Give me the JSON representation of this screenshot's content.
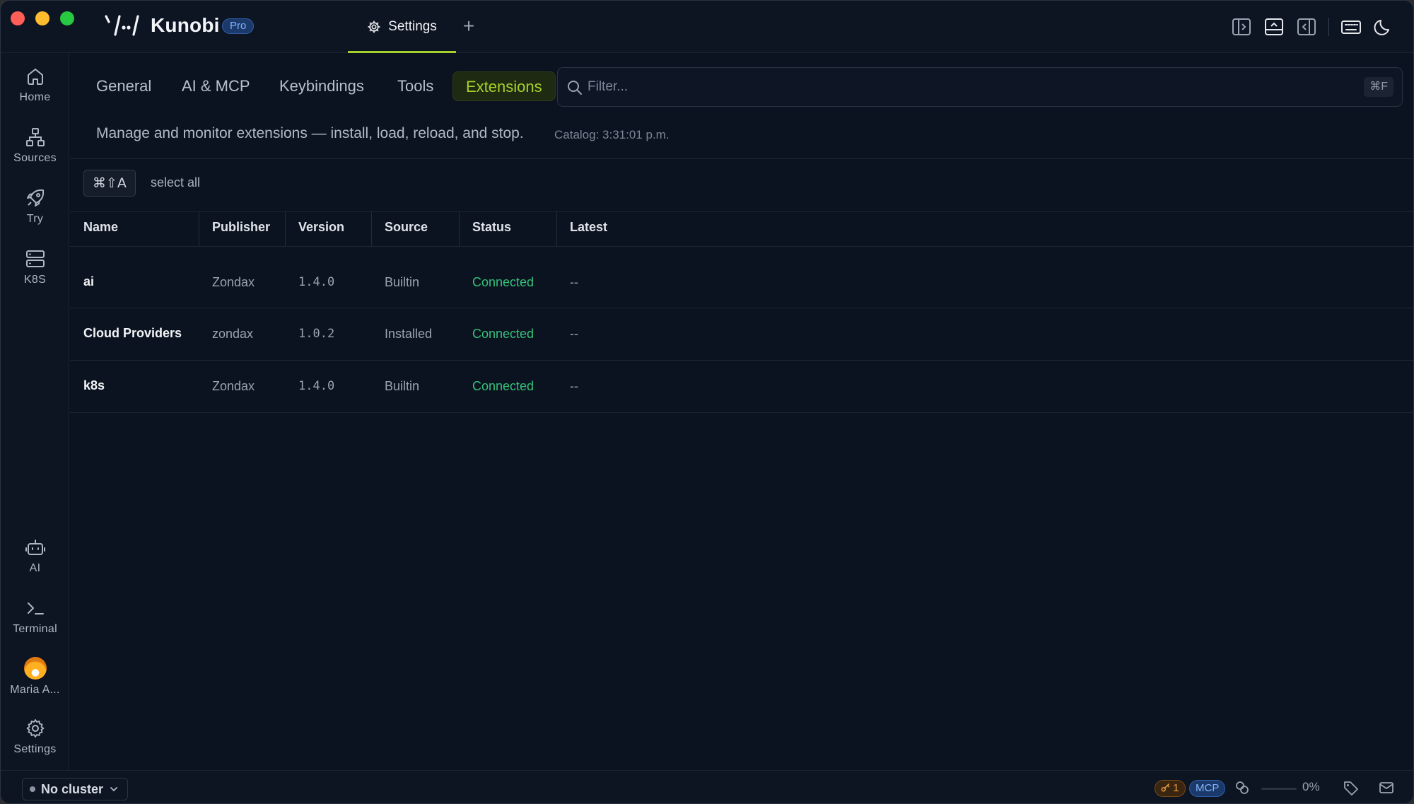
{
  "app": {
    "name": "Kunobi",
    "badge": "Pro"
  },
  "titlebar": {
    "active_tab": "Settings",
    "add_tab": "+"
  },
  "sidebar": {
    "top": [
      {
        "label": "Home",
        "icon": "home-icon"
      },
      {
        "label": "Sources",
        "icon": "sources-icon"
      },
      {
        "label": "Try",
        "icon": "rocket-icon"
      },
      {
        "label": "K8S",
        "icon": "server-icon"
      }
    ],
    "bottom": [
      {
        "label": "AI",
        "icon": "robot-icon"
      },
      {
        "label": "Terminal",
        "icon": "terminal-icon"
      },
      {
        "label": "Maria A...",
        "icon": "avatar"
      },
      {
        "label": "Settings",
        "icon": "gear-icon"
      }
    ]
  },
  "settings_tabs": [
    "General",
    "AI & MCP",
    "Keybindings",
    "Tools",
    "Extensions"
  ],
  "active_settings_tab": "Extensions",
  "filter": {
    "placeholder": "Filter...",
    "shortcut": "⌘F"
  },
  "description": "Manage and monitor extensions — install, load, reload, and stop.",
  "catalog": "Catalog: 3:31:01 p.m.",
  "selection": {
    "shortcut": "⌘⇧A",
    "label": "select all"
  },
  "table": {
    "columns": [
      "Name",
      "Publisher",
      "Version",
      "Source",
      "Status",
      "Latest"
    ],
    "rows": [
      {
        "name": "ai",
        "publisher": "Zondax",
        "version": "1.4.0",
        "source": "Builtin",
        "status": "Connected",
        "latest": "--"
      },
      {
        "name": "Cloud Providers",
        "publisher": "zondax",
        "version": "1.0.2",
        "source": "Installed",
        "status": "Connected",
        "latest": "--"
      },
      {
        "name": "k8s",
        "publisher": "Zondax",
        "version": "1.4.0",
        "source": "Builtin",
        "status": "Connected",
        "latest": "--"
      }
    ]
  },
  "statusbar": {
    "cluster": "No cluster",
    "key_badge": "1",
    "mcp_badge": "MCP",
    "progress_fraction": 0,
    "progress_text": "0%"
  },
  "colors": {
    "accent": "#a6d12a",
    "connected": "#34c27a",
    "background": "#0b1220",
    "pro_badge": "#1b3a6b"
  }
}
